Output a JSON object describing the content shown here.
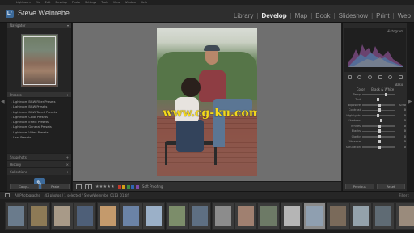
{
  "menu": [
    "Lightroom",
    "File",
    "Edit",
    "Develop",
    "Photo",
    "Settings",
    "Tools",
    "View",
    "Window",
    "Help"
  ],
  "identity_plate": "Steve Weinrebe",
  "modules": [
    {
      "label": "Library",
      "active": false
    },
    {
      "label": "Develop",
      "active": true
    },
    {
      "label": "Map",
      "active": false
    },
    {
      "label": "Book",
      "active": false
    },
    {
      "label": "Slideshow",
      "active": false
    },
    {
      "label": "Print",
      "active": false
    },
    {
      "label": "Web",
      "active": false
    }
  ],
  "left_panel": {
    "navigator_label": "Navigator",
    "presets_label": "Presets",
    "presets": [
      "Lightroom B&W Filter Presets",
      "Lightroom B&W Presets",
      "Lightroom B&W Toned Presets",
      "Lightroom Color Presets",
      "Lightroom Effect Presets",
      "Lightroom General Presets",
      "Lightroom Video Presets",
      "User Presets"
    ],
    "snapshots_label": "Snapshots",
    "history_label": "History",
    "collections_label": "Collections",
    "copy_label": "Copy...",
    "paste_label": "Paste"
  },
  "toolbar": {
    "stars": "★★★★★",
    "soft_proofing": "Soft Proofing",
    "flag_colors": [
      "#c0392b",
      "#d4a017",
      "#3e8e41",
      "#2f66b3",
      "#7d4aa8"
    ]
  },
  "right_panel": {
    "histogram_label": "Histogram",
    "basic_label": "Basic",
    "treatment": [
      "Color",
      "Black & White"
    ],
    "sliders": [
      {
        "name": "Temp",
        "value": ""
      },
      {
        "name": "Tint",
        "value": ""
      },
      {
        "name": "Exposure",
        "value": "0.00"
      },
      {
        "name": "Contrast",
        "value": "0"
      },
      {
        "name": "Highlights",
        "value": "0"
      },
      {
        "name": "Shadows",
        "value": "0"
      },
      {
        "name": "Whites",
        "value": "0"
      },
      {
        "name": "Blacks",
        "value": "0"
      },
      {
        "name": "Clarity",
        "value": "0"
      },
      {
        "name": "Vibrance",
        "value": "0"
      },
      {
        "name": "Saturation",
        "value": "0"
      }
    ],
    "previous_label": "Previous",
    "reset_label": "Reset"
  },
  "filmstrip": {
    "source": "All Photographs",
    "info": "43 photos / 1 selected / SteveWeinrebe_0113_01.tif",
    "filter_label": "Filter :",
    "thumb_colors": [
      "#6a7b8c",
      "#8d7a56",
      "#a89a88",
      "#4e5f78",
      "#c49a6c",
      "#6b83a6",
      "#9bb0c8",
      "#7c8d6a",
      "#5e6f82",
      "#8c8c8c",
      "#a08070",
      "#6d7a66",
      "#b5b5b5",
      "#8f9fb0",
      "#7a6a5a",
      "#94a2ab",
      "#5f6b74",
      "#9a8b7c"
    ]
  }
}
